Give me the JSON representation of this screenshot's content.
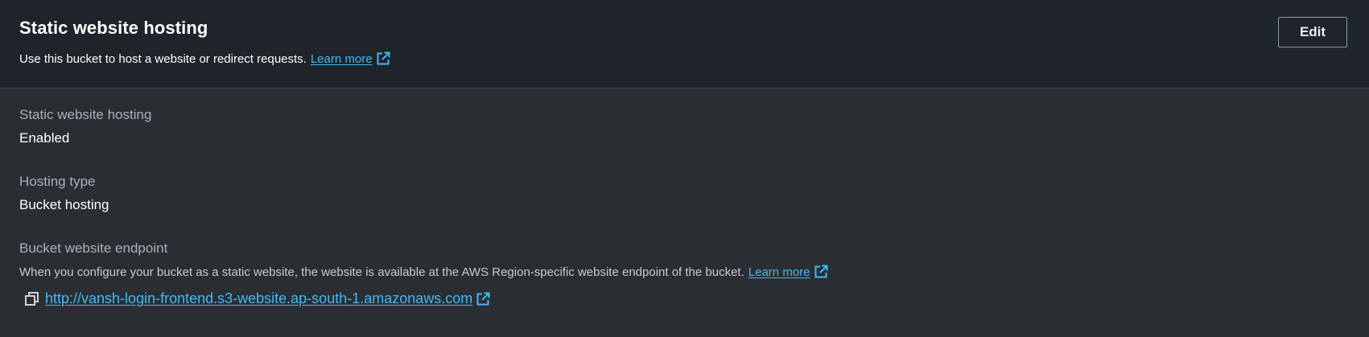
{
  "header": {
    "title": "Static website hosting",
    "description": "Use this bucket to host a website or redirect requests.",
    "learn_more": "Learn more",
    "edit_label": "Edit"
  },
  "fields": {
    "hosting": {
      "label": "Static website hosting",
      "value": "Enabled"
    },
    "hosting_type": {
      "label": "Hosting type",
      "value": "Bucket hosting"
    },
    "endpoint": {
      "label": "Bucket website endpoint",
      "description": "When you configure your bucket as a static website, the website is available at the AWS Region-specific website endpoint of the bucket.",
      "learn_more": "Learn more",
      "url": "http://vansh-login-frontend.s3-website.ap-south-1.amazonaws.com"
    }
  },
  "icons": {
    "external_link": "external-link-icon",
    "copy": "copy-icon"
  },
  "colors": {
    "header_bg": "#1f232a",
    "body_bg": "#2a2e33",
    "link": "#44b9f6",
    "label": "#a8b0bb",
    "text": "#ffffff"
  }
}
